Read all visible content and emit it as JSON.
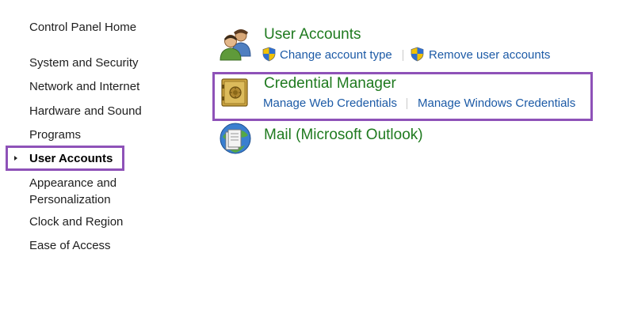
{
  "sidebar": {
    "home": "Control Panel Home",
    "items": [
      {
        "label": "System and Security"
      },
      {
        "label": "Network and Internet"
      },
      {
        "label": "Hardware and Sound"
      },
      {
        "label": "Programs"
      },
      {
        "label": "User Accounts",
        "active": true
      },
      {
        "label": "Appearance and\nPersonalization"
      },
      {
        "label": "Clock and Region"
      },
      {
        "label": "Ease of Access"
      }
    ]
  },
  "categories": {
    "user_accounts": {
      "title": "User Accounts",
      "icon": "users-icon",
      "links": [
        {
          "label": "Change account type",
          "icon": "uac-shield-icon"
        },
        {
          "label": "Remove user accounts",
          "icon": "uac-shield-icon"
        }
      ]
    },
    "credential_manager": {
      "title": "Credential Manager",
      "icon": "vault-icon",
      "links": [
        {
          "label": "Manage Web Credentials"
        },
        {
          "label": "Manage Windows Credentials"
        }
      ]
    },
    "mail": {
      "title": "Mail (Microsoft Outlook)",
      "icon": "mail-icon"
    }
  },
  "colors": {
    "category_title": "#1f7a1f",
    "link": "#1c5aa6",
    "highlight": "#8e52b8"
  }
}
